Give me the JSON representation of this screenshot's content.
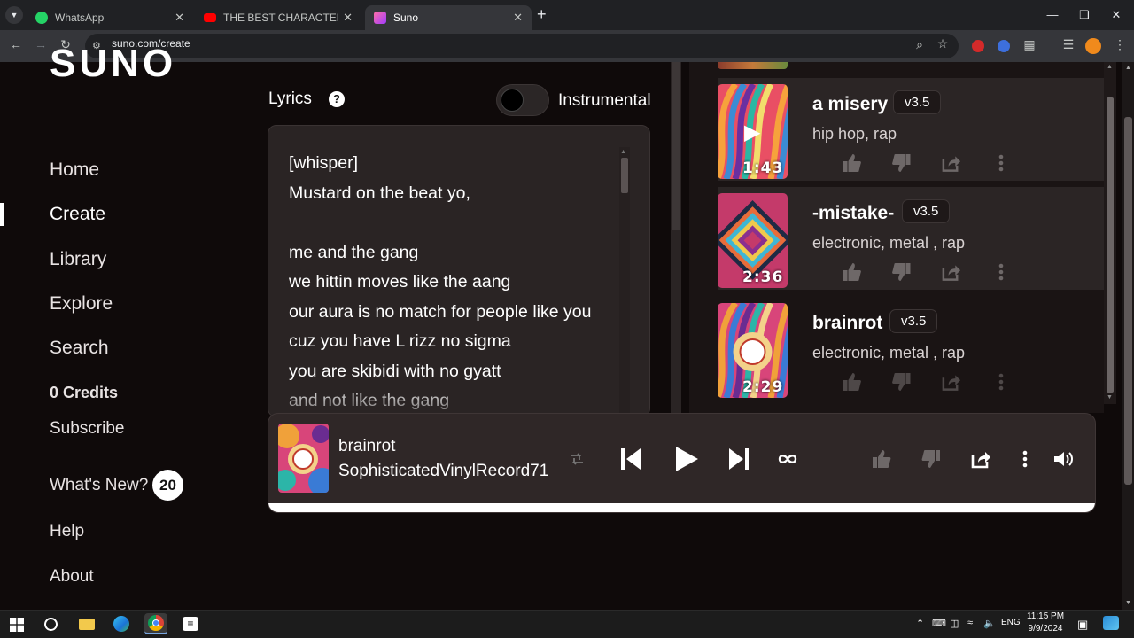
{
  "browser": {
    "tabs": [
      {
        "title": "WhatsApp",
        "favicon": "whatsapp-icon",
        "color": "#25d366",
        "active": false
      },
      {
        "title": "THE BEST CHARACTER IN JUJUTSU",
        "favicon": "youtube-icon",
        "color": "#ff0000",
        "active": false
      },
      {
        "title": "Suno",
        "favicon": "suno-icon",
        "color": "#e84a8a",
        "active": true
      }
    ],
    "new_tab": "+",
    "url": "suno.com/create",
    "window_controls": [
      "minimize-icon",
      "maximize-icon",
      "close-icon"
    ]
  },
  "sidebar": {
    "logo": "SUNO",
    "nav": [
      {
        "label": "Home",
        "current": false
      },
      {
        "label": "Create",
        "current": true
      },
      {
        "label": "Library",
        "current": false
      },
      {
        "label": "Explore",
        "current": false
      },
      {
        "label": "Search",
        "current": false
      }
    ],
    "credits": "0 Credits",
    "subscribe": "Subscribe",
    "whats_new": "What's New?",
    "whats_new_count": "20",
    "help": "Help",
    "about": "About"
  },
  "create": {
    "lyrics_label": "Lyrics",
    "help_icon": "?",
    "instrumental_label": "Instrumental",
    "instrumental_on": false,
    "lyrics_lines": [
      "[whisper]",
      "Mustard on the beat yo,",
      "",
      "me and the gang",
      "we hittin moves like the aang",
      "our aura is no match for people like you",
      "cuz you have L rizz no sigma",
      "you are skibidi with no gyatt",
      "and not like the gang"
    ]
  },
  "songs": [
    {
      "title": "a misery",
      "version": "v3.5",
      "tags": "hip hop, rap",
      "duration": "1:43",
      "highlighted": true,
      "playing_overlay": true
    },
    {
      "title": "-mistake-",
      "version": "v3.5",
      "tags": "electronic, metal , rap",
      "duration": "2:36",
      "highlighted": true,
      "playing_overlay": false
    },
    {
      "title": "brainrot",
      "version": "v3.5",
      "tags": "electronic, metal , rap",
      "duration": "2:29",
      "highlighted": false,
      "playing_overlay": false
    }
  ],
  "player": {
    "title": "brainrot",
    "artist": "SophisticatedVinylRecord71"
  },
  "taskbar": {
    "time": "11:15 PM",
    "date": "9/9/2024",
    "language": "ENG"
  }
}
